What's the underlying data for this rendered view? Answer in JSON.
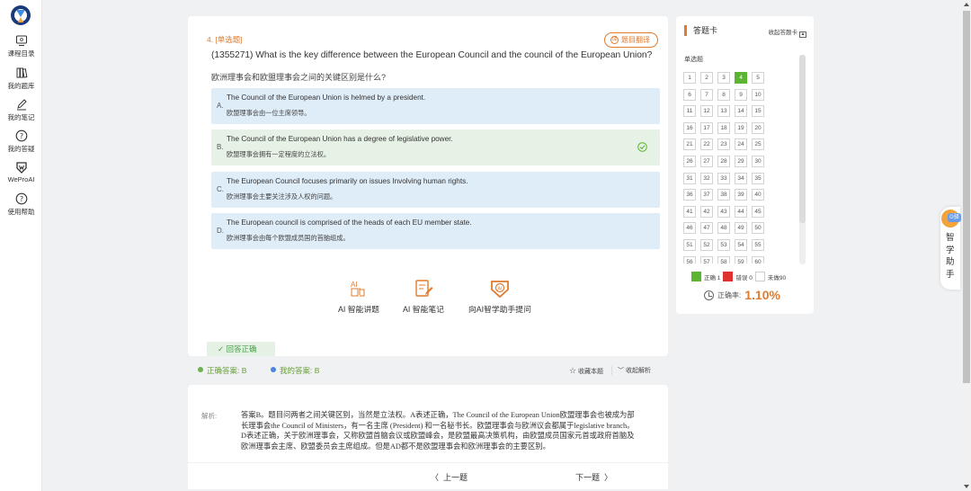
{
  "sidebar": {
    "items": [
      {
        "label": "课程目录",
        "icon": "monitor-icon"
      },
      {
        "label": "我的题库",
        "icon": "books-icon"
      },
      {
        "label": "我的笔记",
        "icon": "pen-icon"
      },
      {
        "label": "我的答疑",
        "icon": "question-icon"
      },
      {
        "label": "WeProAI",
        "icon": "weproai-logo-icon"
      },
      {
        "label": "使用帮助",
        "icon": "help-icon"
      }
    ]
  },
  "question": {
    "type_label": "4. [单选题]",
    "translate_label": "题目翻译",
    "text_en": "(1355271) What is the key difference between the European Council and the council of the European Union?",
    "text_cn": "欧洲理事会和欧盟理事会之间的关键区别是什么?",
    "options": [
      {
        "letter": "A.",
        "en": "The Council of the European Union is helmed by a president.",
        "cn": "欧盟理事会由一位主席领导。"
      },
      {
        "letter": "B.",
        "en": "The Council of the European Union has a degree of legislative power.",
        "cn": "欧盟理事会拥有一定程度的立法权。"
      },
      {
        "letter": "C.",
        "en": "The European Council focuses primarily on issues Involving human rights.",
        "cn": "欧洲理事会主要关注涉及人权的问题。"
      },
      {
        "letter": "D.",
        "en": "The European council is comprised of the heads of each EU member state.",
        "cn": "欧洲理事会由每个欧盟成员国的首脑组成。"
      }
    ]
  },
  "tools": {
    "ai_explain": "AI 智能讲题",
    "ai_notes": "AI 智能笔记",
    "ai_ask": "向AI智学助手提问"
  },
  "result": {
    "tag": "✓ 回答正确",
    "correct_answer": "正确答案: B",
    "my_answer": "我的答案: B",
    "favorite": "收藏本题",
    "collapse_analysis": "收起解析"
  },
  "analysis": {
    "label": "解析:",
    "text": "答案B。题目问两者之间关键区别，当然是立法权。A表述正确，The Council of the European Union欧盟理事会也被成为部长理事会the Council of Ministers，有一名主席 (President) 和一名秘书长。欧盟理事会与欧洲议会都属于legislative branch。D表述正确，关于欧洲理事会，又称欧盟首脑会议或欧盟峰会，是欧盟最高决策机构，由欧盟成员国家元首或政府首脑及欧洲理事会主席、欧盟委员会主席组成。但是AD都不是欧盟理事会和欧洲理事会的主要区别。"
  },
  "nav": {
    "prev": "上一题",
    "next": "下一题"
  },
  "answer_sheet": {
    "title": "答题卡",
    "collapse": "收起答题卡",
    "section": "单选题",
    "current": 4,
    "visible_numbers": [
      1,
      2,
      3,
      4,
      5,
      6,
      7,
      8,
      9,
      10,
      11,
      12,
      13,
      14,
      15,
      16,
      17,
      18,
      19,
      20,
      21,
      22,
      23,
      24,
      25,
      26,
      27,
      28,
      29,
      30,
      31,
      32,
      33,
      34,
      35,
      36,
      37,
      38,
      39,
      40,
      41,
      42,
      43,
      44,
      45,
      46,
      47,
      48,
      49,
      50,
      51,
      52,
      53,
      54,
      55,
      56,
      57,
      58,
      59,
      60
    ],
    "legend_correct": "正确 1",
    "legend_wrong": "错误 0",
    "legend_unanswered": "未做90",
    "rate_label": "正确率:",
    "rate_value": "1.10%",
    "colors": {
      "correct": "#5cb531",
      "wrong": "#e03131",
      "accent": "#e07b2f"
    }
  },
  "assistant": {
    "label": "智学助手",
    "badge": "G驿"
  }
}
